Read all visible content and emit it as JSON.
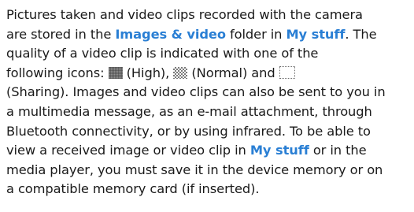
{
  "paragraph": {
    "l1": "Pictures taken and video clips recorded with the camera",
    "l2a": "are stored in the ",
    "l2_link_images": "Images & video",
    "l2b": " folder in ",
    "l2_link_mystuff": "My stuff",
    "l2c": ". The",
    "l3": "quality of a video clip is indicated with one of the",
    "l4a": "following icons: ",
    "l4b": " (High), ",
    "l4c": " (Normal) and ",
    "l5": "(Sharing). Images and video clips can also be sent to you in",
    "l6": "a multimedia message, as an e-mail attachment, through",
    "l7": "Bluetooth connectivity, or by using infrared. To be able to",
    "l8a": "view a received image or video clip in ",
    "l8_link_mystuff": "My stuff",
    "l8b": " or in the",
    "l9": "media player, you must save it in the device memory or on",
    "l10": "a compatible memory card (if inserted)."
  },
  "icons": {
    "high": "video-quality-high-icon",
    "normal": "video-quality-normal-icon",
    "sharing": "video-quality-sharing-icon"
  },
  "colors": {
    "text": "#1a1a1a",
    "highlight": "#2a7fd4"
  }
}
